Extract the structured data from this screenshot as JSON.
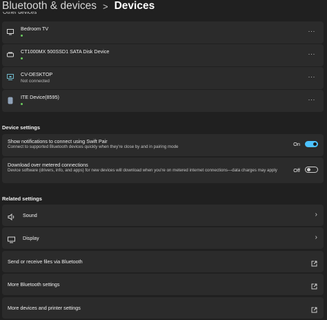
{
  "header": {
    "parent": "Bluetooth & devices",
    "separator": ">",
    "current": "Devices"
  },
  "other_devices": {
    "peek_label": "Other devices",
    "items": [
      {
        "name": "Bedroom TV",
        "status": "",
        "icon": "tv-icon",
        "connected": true
      },
      {
        "name": "CT1000MX 500SSD1 SATA Disk Device",
        "status": "",
        "icon": "disk-drive-icon",
        "connected": true
      },
      {
        "name": "CV-DESKTOP",
        "status": "Not connected",
        "icon": "display-device-icon",
        "connected": false
      },
      {
        "name": "ITE Device(8595)",
        "status": "",
        "icon": "usb-device-icon",
        "connected": true
      }
    ],
    "more_label": "···"
  },
  "device_settings": {
    "title": "Device settings",
    "swift_pair": {
      "title": "Show notifications to connect using Swift Pair",
      "desc": "Connect to supported Bluetooth devices quickly when they're close by and in pairing mode",
      "state_label": "On",
      "on": true
    },
    "metered": {
      "title": "Download over metered connections",
      "desc": "Device software (drivers, info, and apps) for new devices will download when you're on metered internet connections—data charges may apply",
      "state_label": "Off",
      "on": false
    }
  },
  "related_settings": {
    "title": "Related settings",
    "items": [
      {
        "label": "Sound",
        "icon": "speaker-icon",
        "action": "chevron"
      },
      {
        "label": "Display",
        "icon": "monitor-icon",
        "action": "chevron"
      },
      {
        "label": "Send or receive files via Bluetooth",
        "icon": "",
        "action": "external"
      },
      {
        "label": "More Bluetooth settings",
        "icon": "",
        "action": "external"
      },
      {
        "label": "More devices and printer settings",
        "icon": "",
        "action": "external"
      }
    ],
    "chevron": "›"
  },
  "colors": {
    "background": "#202020",
    "card": "#2b2b2b",
    "accent": "#4cc2ff",
    "connected_dot": "#6ccb5f"
  }
}
